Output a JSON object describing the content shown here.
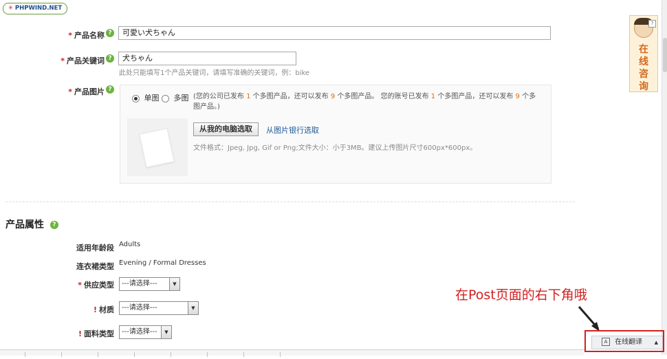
{
  "brand": {
    "logo_text": "PHPWIND.NET",
    "logo_mark": "✳"
  },
  "form": {
    "product_name": {
      "label": "产品名称",
      "value": "可愛い犬ちゃん"
    },
    "product_keyword": {
      "label": "产品关键词",
      "value": "犬ちゃん",
      "hint": "此处只能填写1个产品关键词，请填写准确的关键词，例：bike"
    },
    "product_image": {
      "label": "产品图片",
      "mode_single": "单图",
      "mode_multi": "多图",
      "quota_text_1": "(您的公司已发布",
      "quota_n1": "1",
      "quota_text_2": "个多图产品，还可以发布",
      "quota_n2": "9",
      "quota_text_3": "个多图产品。 您的账号已发布",
      "quota_n3": "1",
      "quota_text_4": "个多图产品，还可以发布",
      "quota_n4": "9",
      "quota_text_5": "个多",
      "quota_text_6": "图产品。)",
      "upload_button": "从我的电脑选取",
      "bank_link": "从图片银行选取",
      "file_hint": "文件格式：Jpeg, Jpg, Gif or Png;文件大小：小于3MB。建议上传图片尺寸600px*600px。"
    }
  },
  "attributes": {
    "title": "产品属性",
    "age_range": {
      "label": "适用年龄段",
      "value": "Adults"
    },
    "dress_type": {
      "label": "连衣裙类型",
      "value": "Evening / Formal Dresses"
    },
    "supply_type": {
      "label": "供应类型",
      "selected": "---请选择---"
    },
    "material": {
      "label": "材质",
      "selected": "---请选择---"
    },
    "fabric_type": {
      "label": "面料类型",
      "selected": "---请选择---"
    }
  },
  "consult": {
    "text": "在线咨询"
  },
  "annotation": {
    "text": "在Post页面的右下角哦"
  },
  "translate_bar": {
    "label": "在线翻译",
    "icon_letter": "A"
  },
  "colors": {
    "accent_red": "#d12020",
    "help_green": "#6db33f",
    "quota_orange": "#e36c0a",
    "link_blue": "#1f5a99"
  }
}
